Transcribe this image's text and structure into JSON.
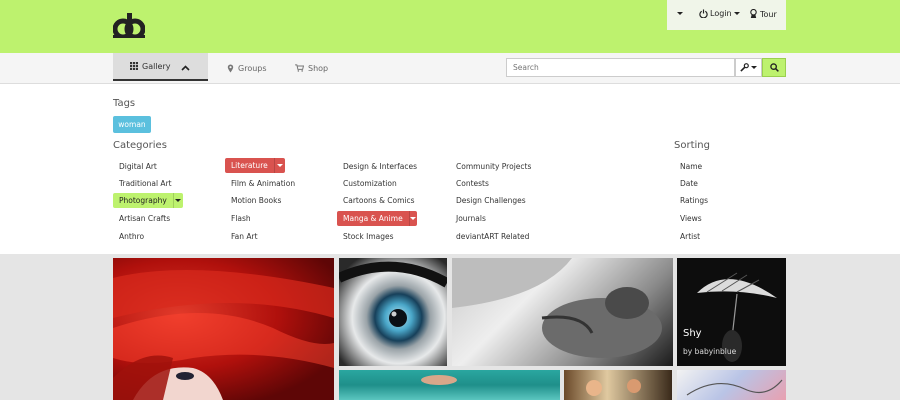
{
  "header": {
    "login_label": "Login",
    "tour_label": "Tour"
  },
  "nav": {
    "gallery_label": "Gallery",
    "groups_label": "Groups",
    "shop_label": "Shop"
  },
  "search": {
    "placeholder": "Search"
  },
  "filters": {
    "tags_heading": "Tags",
    "tags": [
      "woman"
    ],
    "categories_heading": "Categories",
    "sorting_heading": "Sorting",
    "categories_col1": [
      "Digital Art",
      "Traditional Art",
      "Photography",
      "Artisan Crafts",
      "Anthro"
    ],
    "categories_col2": [
      "Literature",
      "Film & Animation",
      "Motion Books",
      "Flash",
      "Fan Art"
    ],
    "categories_col3": [
      "Design & Interfaces",
      "Customization",
      "Cartoons & Comics",
      "Manga & Anime",
      "Stock Images"
    ],
    "categories_col4": [
      "Community Projects",
      "Contests",
      "Design Challenges",
      "Journals",
      "deviantART Related"
    ],
    "sorting": [
      "Name",
      "Date",
      "Ratings",
      "Views",
      "Artist"
    ]
  },
  "gallery": {
    "featured": {
      "title": "Shy",
      "artist_line": "by babyinblue"
    }
  },
  "colors": {
    "brand_green": "#bdf26e",
    "tag_blue": "#5bc0de",
    "selected_red": "#d9534f"
  }
}
